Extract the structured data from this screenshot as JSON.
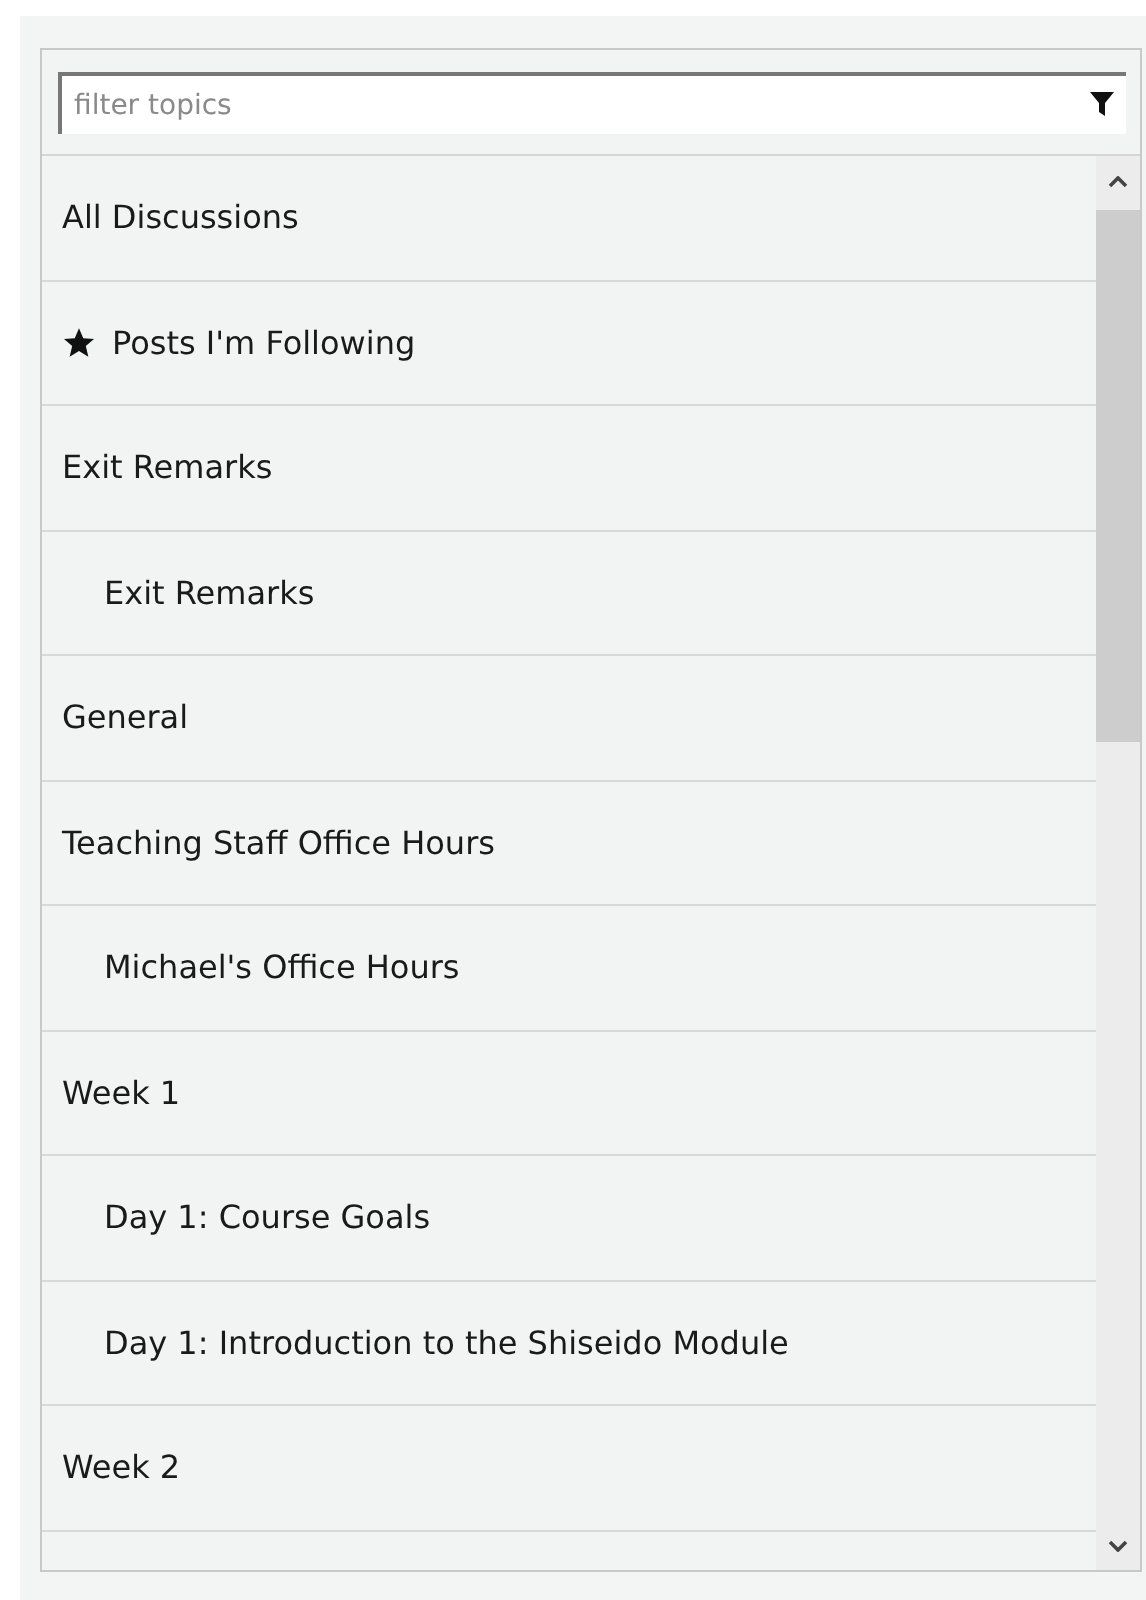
{
  "search": {
    "placeholder": "filter topics"
  },
  "topics": [
    {
      "kind": "link",
      "label": "All Discussions"
    },
    {
      "kind": "following",
      "label": "Posts I'm Following"
    },
    {
      "kind": "link",
      "label": "Exit Remarks",
      "children": [
        {
          "kind": "link",
          "label": "Exit Remarks"
        }
      ]
    },
    {
      "kind": "link",
      "label": "General"
    },
    {
      "kind": "link",
      "label": "Teaching Staff Office Hours",
      "children": [
        {
          "kind": "link",
          "label": "Michael's Office Hours"
        }
      ]
    },
    {
      "kind": "link",
      "label": "Week 1",
      "children": [
        {
          "kind": "link",
          "label": "Day 1: Course Goals"
        },
        {
          "kind": "link",
          "label": "Day 1: Introduction to the Shiseido Module"
        }
      ]
    },
    {
      "kind": "link",
      "label": "Week 2"
    }
  ]
}
